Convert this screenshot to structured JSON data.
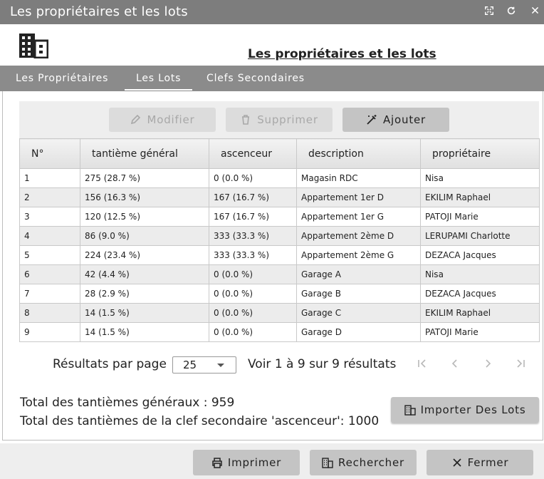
{
  "window": {
    "title": "Les propriétaires et les lots"
  },
  "page_title": "Les propriétaires et les lots",
  "tabs": [
    {
      "label": "Les Propriétaires",
      "active": false
    },
    {
      "label": "Les Lots",
      "active": true
    },
    {
      "label": "Clefs Secondaires",
      "active": false
    }
  ],
  "toolbar": {
    "modify": "Modifier",
    "delete": "Supprimer",
    "add": "Ajouter"
  },
  "table": {
    "headers": [
      "N°",
      "tantième général",
      "ascenceur",
      "description",
      "propriétaire"
    ],
    "rows": [
      [
        "1",
        "275 (28.7 %)",
        "0 (0.0 %)",
        "Magasin RDC",
        "Nisa"
      ],
      [
        "2",
        "156 (16.3 %)",
        "167 (16.7 %)",
        "Appartement 1er D",
        "EKILIM Raphael"
      ],
      [
        "3",
        "120 (12.5 %)",
        "167 (16.7 %)",
        "Appartement 1er G",
        "PATOJI Marie"
      ],
      [
        "4",
        "86 (9.0 %)",
        "333 (33.3 %)",
        "Appartement 2ème D",
        "LERUPAMI Charlotte"
      ],
      [
        "5",
        "224 (23.4 %)",
        "333 (33.3 %)",
        "Appartement 2ème G",
        "DEZACA Jacques"
      ],
      [
        "6",
        "42 (4.4 %)",
        "0 (0.0 %)",
        "Garage A",
        "Nisa"
      ],
      [
        "7",
        "28 (2.9 %)",
        "0 (0.0 %)",
        "Garage B",
        "DEZACA Jacques"
      ],
      [
        "8",
        "14 (1.5 %)",
        "0 (0.0 %)",
        "Garage C",
        "EKILIM Raphael"
      ],
      [
        "9",
        "14 (1.5 %)",
        "0 (0.0 %)",
        "Garage D",
        "PATOJI Marie"
      ]
    ]
  },
  "pager": {
    "label": "Résultats par page",
    "page_size": "25",
    "info": "Voir 1 à 9 sur 9 résultats"
  },
  "totals": {
    "general": "Total des tantièmes généraux : 959",
    "secondary": "Total des tantièmes de la clef secondaire 'ascenceur': 1000"
  },
  "import_button": "Importer Des Lots",
  "footer": {
    "print": "Imprimer",
    "search": "Rechercher",
    "close": "Fermer"
  },
  "colors": {
    "titlebar": "#7d7d7d",
    "tabbar": "#8b8b8b",
    "button": "#c4c4c4",
    "disabled": "#dcdcdc"
  }
}
